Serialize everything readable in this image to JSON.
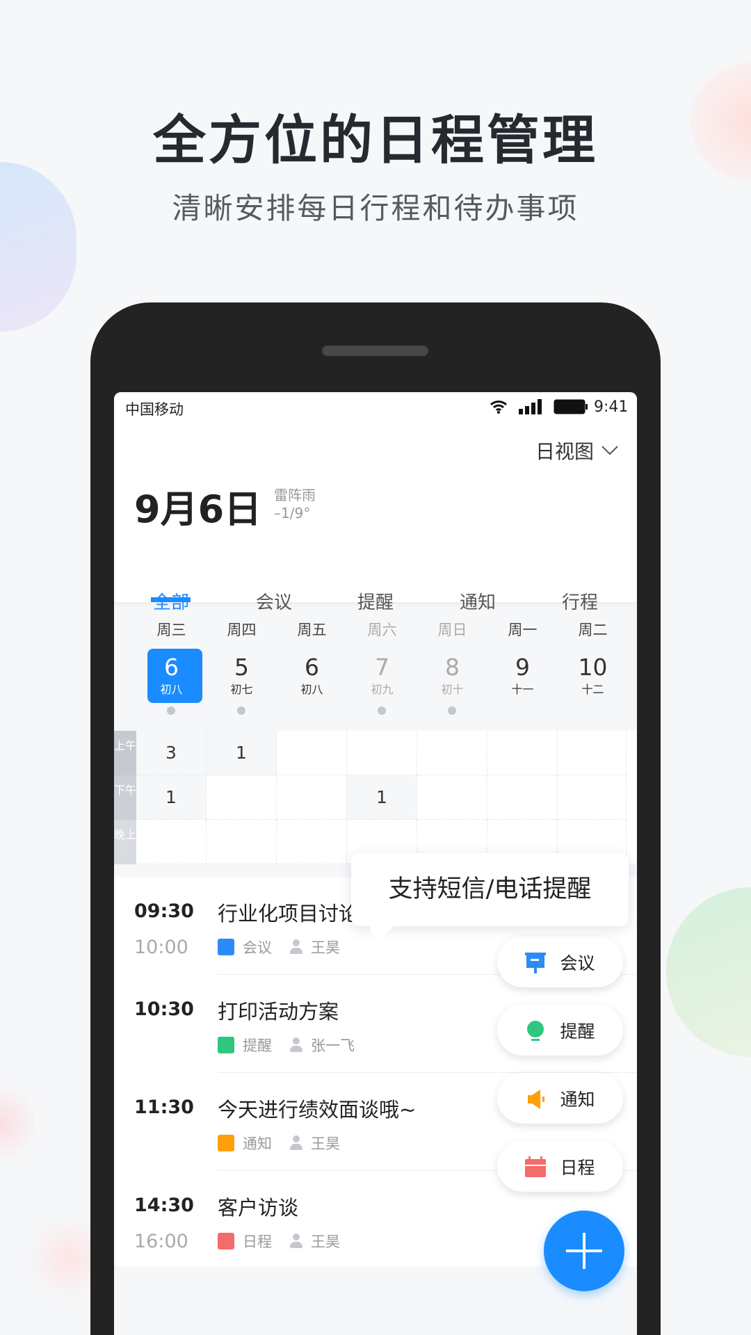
{
  "hero": {
    "title": "全方位的日程管理",
    "subtitle": "清晰安排每日行程和待办事项"
  },
  "status": {
    "carrier": "中国移动",
    "time": "9:41"
  },
  "header": {
    "view_selector": "日视图",
    "date": "9月6日",
    "weather": "雷阵雨",
    "temp": "–1/9°"
  },
  "tabs": [
    {
      "label": "全部",
      "active": true
    },
    {
      "label": "会议"
    },
    {
      "label": "提醒"
    },
    {
      "label": "通知"
    },
    {
      "label": "行程"
    }
  ],
  "week": [
    {
      "weekday": "周三",
      "day": "6",
      "lunar": "初八",
      "selected": true,
      "dot": true
    },
    {
      "weekday": "周四",
      "day": "5",
      "lunar": "初七",
      "dot": true
    },
    {
      "weekday": "周五",
      "day": "6",
      "lunar": "初八"
    },
    {
      "weekday": "周六",
      "day": "7",
      "lunar": "初九",
      "weekend": true,
      "dot": true
    },
    {
      "weekday": "周日",
      "day": "8",
      "lunar": "初十",
      "weekend": true,
      "dot": true
    },
    {
      "weekday": "周一",
      "day": "9",
      "lunar": "十一"
    },
    {
      "weekday": "周二",
      "day": "10",
      "lunar": "十二"
    }
  ],
  "grid": {
    "rows": [
      {
        "label": "上午",
        "counts": [
          "3",
          "1",
          "",
          "",
          "",
          "",
          ""
        ]
      },
      {
        "label": "下午",
        "counts": [
          "1",
          "",
          "",
          "1",
          "",
          "",
          ""
        ]
      },
      {
        "label": "晚上",
        "counts": [
          "",
          "",
          "",
          "",
          "",
          "",
          ""
        ]
      }
    ]
  },
  "events": [
    {
      "start": "09:30",
      "end": "10:00",
      "title": "行业化项目讨论会",
      "type": "会议",
      "person": "王昊",
      "color": "#2b8cf7"
    },
    {
      "start": "10:30",
      "end": "",
      "title": "打印活动方案",
      "type": "提醒",
      "person": "张一飞",
      "color": "#2fc77f"
    },
    {
      "start": "11:30",
      "end": "",
      "title": "今天进行绩效面谈哦~",
      "type": "通知",
      "person": "王昊",
      "color": "#ff9f0a"
    },
    {
      "start": "14:30",
      "end": "16:00",
      "title": "客户访谈",
      "type": "日程",
      "person": "王昊",
      "color": "#f46b6b"
    }
  ],
  "tooltip": "支持短信/电话提醒",
  "quick_add": [
    {
      "label": "会议",
      "icon": "meeting-icon",
      "color": "#2b8cf7"
    },
    {
      "label": "提醒",
      "icon": "bulb-icon",
      "color": "#2fc77f"
    },
    {
      "label": "通知",
      "icon": "speaker-icon",
      "color": "#ff9f0a"
    },
    {
      "label": "日程",
      "icon": "calendar-icon",
      "color": "#f46b6b"
    }
  ],
  "colors": {
    "accent": "#1a8cff"
  }
}
